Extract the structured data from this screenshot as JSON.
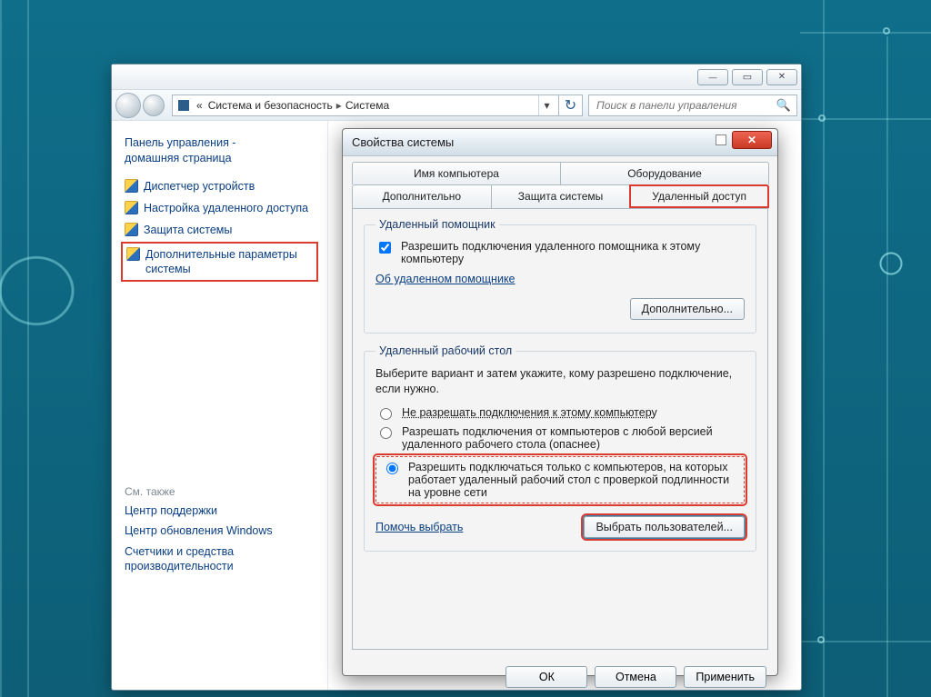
{
  "cp": {
    "breadcrumb_sep": "«",
    "breadcrumb1": "Система и безопасность",
    "breadcrumb2": "Система",
    "search_placeholder": "Поиск в панели управления"
  },
  "sidebar": {
    "home1": "Панель управления -",
    "home2": "домашняя страница",
    "items": [
      {
        "label": "Диспетчер устройств"
      },
      {
        "label": "Настройка удаленного доступа"
      },
      {
        "label": "Защита системы"
      },
      {
        "label": "Дополнительные параметры системы"
      }
    ],
    "see_also": "См. также",
    "links": [
      {
        "label": "Центр поддержки"
      },
      {
        "label": "Центр обновления Windows"
      },
      {
        "label": "Счетчики и средства производительности"
      }
    ]
  },
  "dialog": {
    "title": "Свойства системы",
    "tabs_row1": [
      "Имя компьютера",
      "Оборудование"
    ],
    "tabs_row2": [
      "Дополнительно",
      "Защита системы",
      "Удаленный доступ"
    ],
    "group_assist": "Удаленный помощник",
    "chk_assist": "Разрешить подключения удаленного помощника к этому компьютеру",
    "link_assist": "Об удаленном помощнике",
    "btn_more": "Дополнительно...",
    "group_rdp": "Удаленный рабочий стол",
    "rdp_desc": "Выберите вариант и затем укажите, кому разрешено подключение, если нужно.",
    "rdp_opt1": "Не разрешать подключения к этому компьютеру",
    "rdp_opt2": "Разрешать подключения от компьютеров с любой версией удаленного рабочего стола (опаснее)",
    "rdp_opt3": "Разрешить подключаться только с компьютеров, на которых работает удаленный рабочий стол с проверкой подлинности на уровне сети",
    "link_help": "Помочь выбрать",
    "btn_users": "Выбрать пользователей...",
    "btn_ok": "ОК",
    "btn_cancel": "Отмена",
    "btn_apply": "Применить"
  }
}
